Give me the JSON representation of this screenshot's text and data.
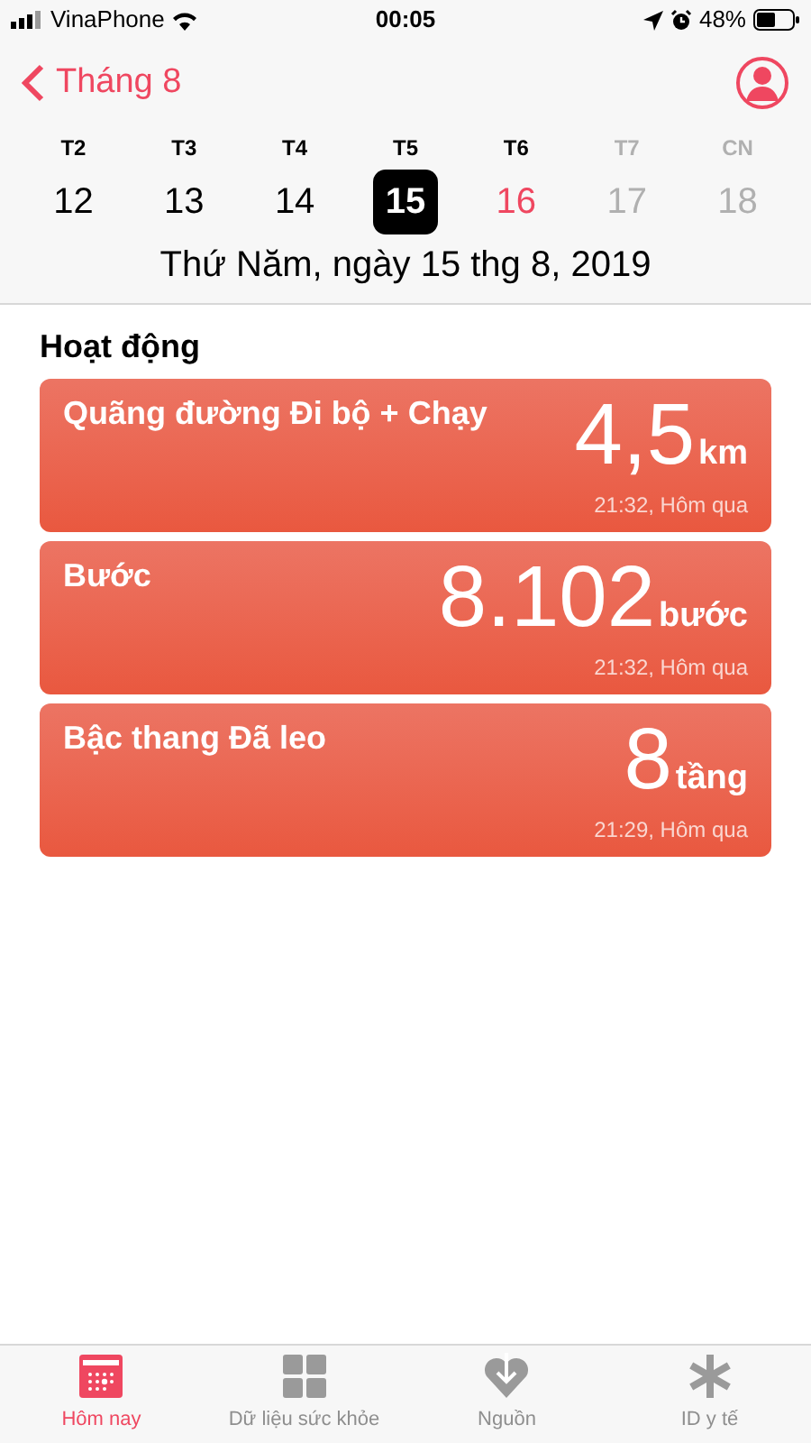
{
  "status_bar": {
    "carrier": "VinaPhone",
    "time": "00:05",
    "battery": "48%"
  },
  "nav": {
    "back": "Tháng 8"
  },
  "week": [
    {
      "label": "T2",
      "date": "12",
      "selected": false,
      "kind": "normal"
    },
    {
      "label": "T3",
      "date": "13",
      "selected": false,
      "kind": "normal"
    },
    {
      "label": "T4",
      "date": "14",
      "selected": false,
      "kind": "normal"
    },
    {
      "label": "T5",
      "date": "15",
      "selected": true,
      "kind": "normal"
    },
    {
      "label": "T6",
      "date": "16",
      "selected": false,
      "kind": "today"
    },
    {
      "label": "T7",
      "date": "17",
      "selected": false,
      "kind": "future"
    },
    {
      "label": "CN",
      "date": "18",
      "selected": false,
      "kind": "future"
    }
  ],
  "date_title": "Thứ Năm, ngày 15 thg 8, 2019",
  "section_title": "Hoạt động",
  "cards": [
    {
      "title": "Quãng đường Đi bộ + Chạy",
      "value": "4,5",
      "unit": "km",
      "time": "21:32, Hôm qua"
    },
    {
      "title": "Bước",
      "value": "8.102",
      "unit": "bước",
      "time": "21:32, Hôm qua"
    },
    {
      "title": "Bậc thang Đã leo",
      "value": "8",
      "unit": "tầng",
      "time": "21:29, Hôm qua"
    }
  ],
  "tabs": [
    {
      "label": "Hôm nay",
      "kind": "calendar",
      "selected": true
    },
    {
      "label": "Dữ liệu sức khỏe",
      "kind": "grid",
      "selected": false
    },
    {
      "label": "Nguồn",
      "kind": "heart",
      "selected": false
    },
    {
      "label": "ID y tế",
      "kind": "asterisk",
      "selected": false
    }
  ]
}
